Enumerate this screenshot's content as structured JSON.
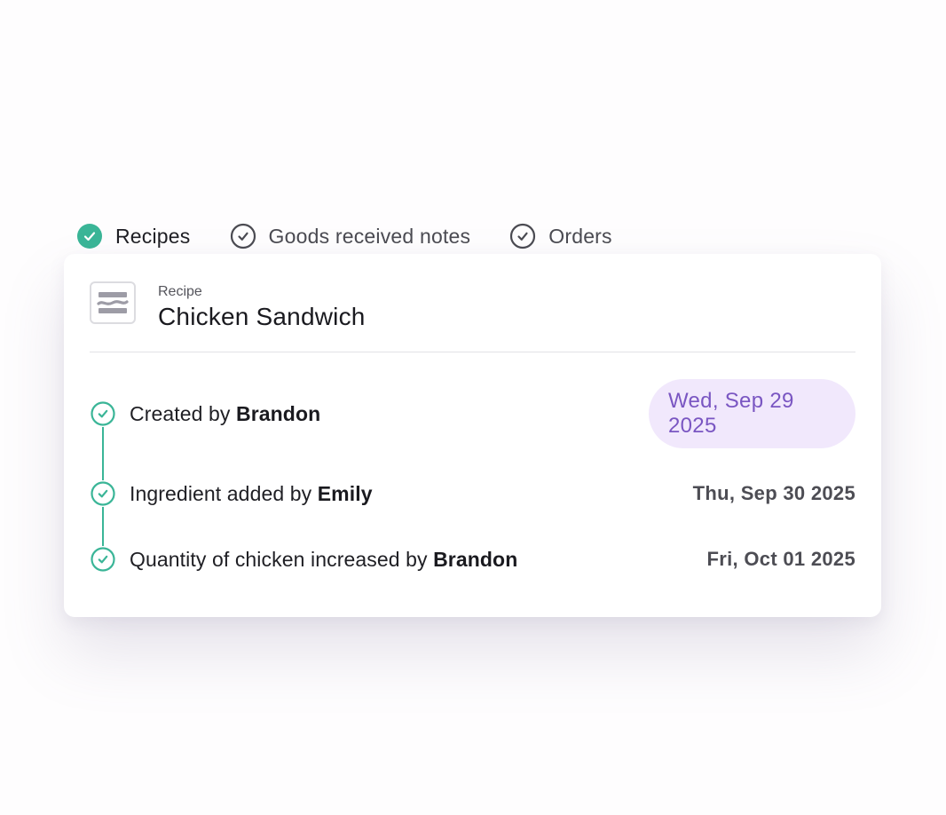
{
  "tabs": [
    {
      "label": "Recipes",
      "state": "complete",
      "icon": "check-circle-filled-icon"
    },
    {
      "label": "Goods received notes",
      "state": "pending",
      "icon": "check-circle-outline-icon"
    },
    {
      "label": "Orders",
      "state": "pending",
      "icon": "check-circle-outline-icon"
    }
  ],
  "card": {
    "type_label": "Recipe",
    "title": "Chicken Sandwich",
    "icon": "sandwich-icon"
  },
  "events": [
    {
      "prefix": "Created by ",
      "actor": "Brandon",
      "date": "Wed, Sep 29 2025",
      "highlighted": true
    },
    {
      "prefix": "Ingredient added by ",
      "actor": "Emily",
      "date": "Thu, Sep 30 2025",
      "highlighted": false
    },
    {
      "prefix": "Quantity of chicken increased by ",
      "actor": "Brandon",
      "date": "Fri, Oct 01 2025",
      "highlighted": false
    }
  ],
  "colors": {
    "accent_green": "#3ab597",
    "highlight_bg": "#f1e8fc",
    "highlight_text": "#7a56c2",
    "icon_gray": "#9d9ca6"
  }
}
